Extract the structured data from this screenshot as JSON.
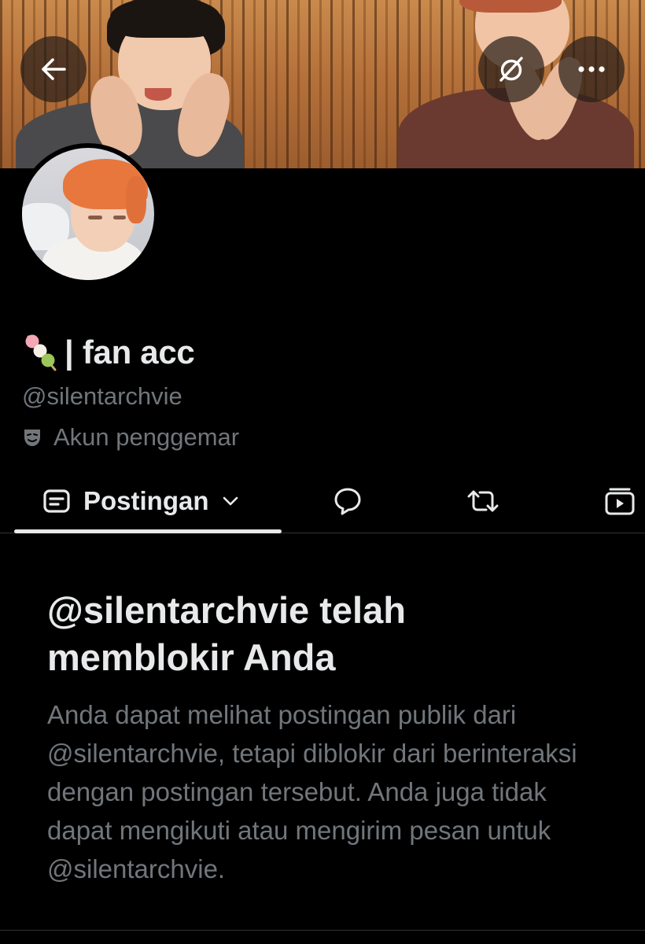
{
  "profile": {
    "display_name": "| fan acc",
    "name_emoji": "dango-emoji",
    "handle": "@silentarchvie",
    "category_icon": "performing-arts-mask-icon",
    "category": "Akun penggemar"
  },
  "header": {
    "back_icon": "arrow-left-icon",
    "slash_icon": "circle-slash-icon",
    "more_icon": "more-horizontal-icon"
  },
  "tabs": {
    "active_label": "Postingan",
    "active_icon": "posts-icon",
    "dropdown_icon": "chevron-down-icon",
    "items": [
      {
        "icon": "reply-bubble-icon"
      },
      {
        "icon": "repost-icon"
      },
      {
        "icon": "media-video-icon"
      }
    ]
  },
  "blocked": {
    "title": "@silentarchvie telah memblokir Anda",
    "body": "Anda dapat melihat postingan publik dari @silentarchvie, tetapi diblokir dari berinteraksi dengan postingan tersebut. Anda juga tidak dapat mengikuti atau mengirim pesan untuk @silentarchvie."
  },
  "colors": {
    "background": "#000000",
    "text_primary": "#e7e9ea",
    "text_secondary": "#71767b",
    "divider": "#2f3336"
  }
}
